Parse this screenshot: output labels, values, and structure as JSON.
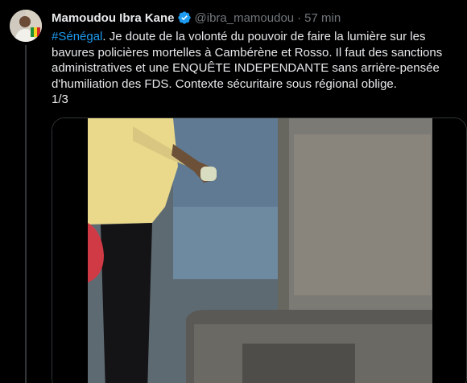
{
  "tweet": {
    "author": {
      "display_name": "Mamoudou Ibra Kane",
      "handle": "@ibra_mamoudou",
      "verified_icon": "verified-badge-icon",
      "verified_color": "#1d9bf0"
    },
    "separator": "·",
    "timestamp": "57 min",
    "hashtag": "#Sénégal",
    "text": ". Je doute de la volonté du pouvoir de faire la lumière sur les bavures policières mortelles à Cambérène et Rosso. Il faut des sanctions administratives et une ENQUÊTE INDEPENDANTE sans arrière-pensée d'humiliation des FDS. Contexte sécuritaire sous régional oblige.\n1/3",
    "media": {
      "type": "video",
      "icon": "video-thumbnail"
    }
  },
  "colors": {
    "background": "#000000",
    "text": "#e7e9ea",
    "secondary": "#71767b",
    "link": "#1d9bf0",
    "border": "#2f3336"
  }
}
